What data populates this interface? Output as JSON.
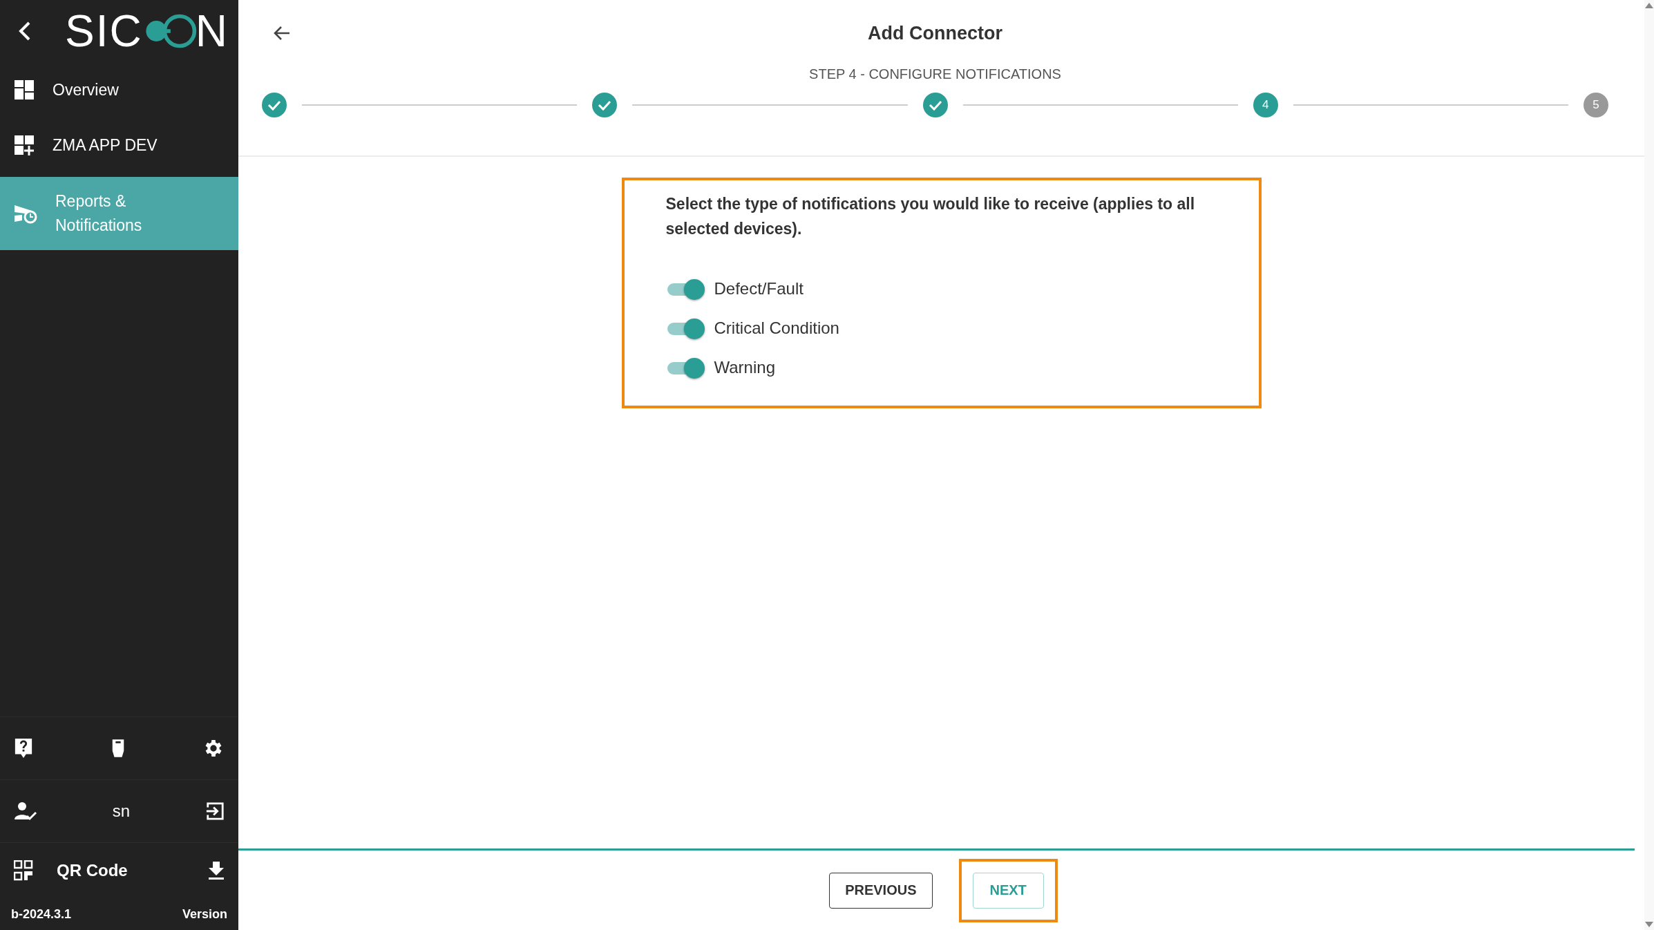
{
  "sidebar": {
    "logo": {
      "prefix": "SIC",
      "suffix": "N"
    },
    "items": [
      {
        "label": "Overview",
        "selected": false
      },
      {
        "label": "ZMA APP DEV",
        "selected": false
      },
      {
        "label": "Reports & Notifications",
        "selected": true
      }
    ],
    "user": {
      "name": "sn"
    },
    "qr": {
      "label": "QR Code"
    },
    "version": {
      "build": "b-2024.3.1",
      "label": "Version"
    }
  },
  "header": {
    "title": "Add Connector",
    "step_label": "STEP 4 - CONFIGURE NOTIFICATIONS"
  },
  "steps": [
    {
      "completed": true,
      "selected": false
    },
    {
      "completed": true,
      "selected": false
    },
    {
      "completed": true,
      "selected": false
    },
    {
      "completed": false,
      "number": "4",
      "selected": true
    },
    {
      "completed": false,
      "number": "5",
      "selected": false
    }
  ],
  "panel": {
    "highlighted": true,
    "instruction": "Select the type of notifications you would like to receive (applies to all selected devices).",
    "toggles": [
      {
        "label": "Defect/Fault",
        "on": true
      },
      {
        "label": "Critical Condition",
        "on": true
      },
      {
        "label": "Warning",
        "on": true
      }
    ]
  },
  "footer": {
    "buttons": [
      {
        "label": "PREVIOUS",
        "kind": "outline",
        "highlighted": false
      },
      {
        "label": "NEXT",
        "kind": "primary",
        "highlighted": true
      }
    ]
  }
}
